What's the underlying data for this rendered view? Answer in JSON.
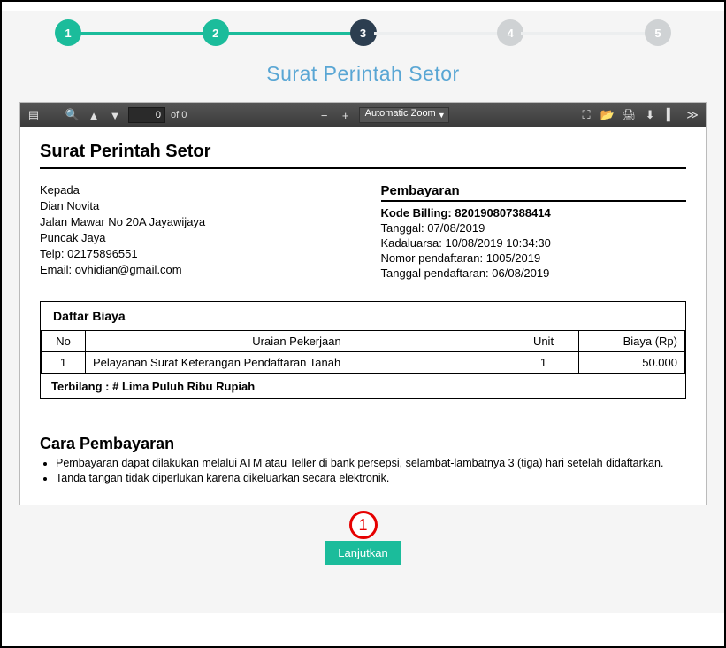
{
  "stepper": {
    "steps": [
      "1",
      "2",
      "3",
      "4",
      "5"
    ],
    "current_index": 2
  },
  "page_title": "Surat Perintah Setor",
  "pdf_toolbar": {
    "page_input": "0",
    "page_total": "of 0",
    "zoom_label": "Automatic Zoom"
  },
  "document": {
    "title": "Surat Perintah Setor",
    "kepada": {
      "label": "Kepada",
      "name": "Dian Novita",
      "address1": "Jalan Mawar No 20A Jayawijaya",
      "address2": "Puncak Jaya",
      "telp_label": "Telp:",
      "telp": "02175896551",
      "email_label": "Email:",
      "email": "ovhidian@gmail.com"
    },
    "pembayaran": {
      "title": "Pembayaran",
      "kode_billing_label": "Kode Billing:",
      "kode_billing": "820190807388414",
      "tanggal_label": "Tanggal:",
      "tanggal": "07/08/2019",
      "kadaluarsa_label": "Kadaluarsa:",
      "kadaluarsa": "10/08/2019 10:34:30",
      "nomor_label": "Nomor pendaftaran:",
      "nomor": "1005/2019",
      "tgl_daftar_label": "Tanggal pendaftaran:",
      "tgl_daftar": "06/08/2019"
    },
    "daftar_biaya": {
      "title": "Daftar Biaya",
      "headers": {
        "no": "No",
        "uraian": "Uraian Pekerjaan",
        "unit": "Unit",
        "biaya": "Biaya (Rp)"
      },
      "rows": [
        {
          "no": "1",
          "uraian": "Pelayanan Surat Keterangan Pendaftaran Tanah",
          "unit": "1",
          "biaya": "50.000"
        }
      ],
      "terbilang_label": "Terbilang :",
      "terbilang": "# Lima Puluh Ribu  Rupiah"
    },
    "cara": {
      "title": "Cara Pembayaran",
      "items": [
        "Pembayaran dapat dilakukan melalui ATM atau Teller di bank persepsi, selambat-lambatnya 3 (tiga) hari setelah didaftarkan.",
        "Tanda tangan tidak diperlukan karena dikeluarkan secara elektronik."
      ]
    }
  },
  "annotation": {
    "num": "1"
  },
  "continue_label": "Lanjutkan"
}
